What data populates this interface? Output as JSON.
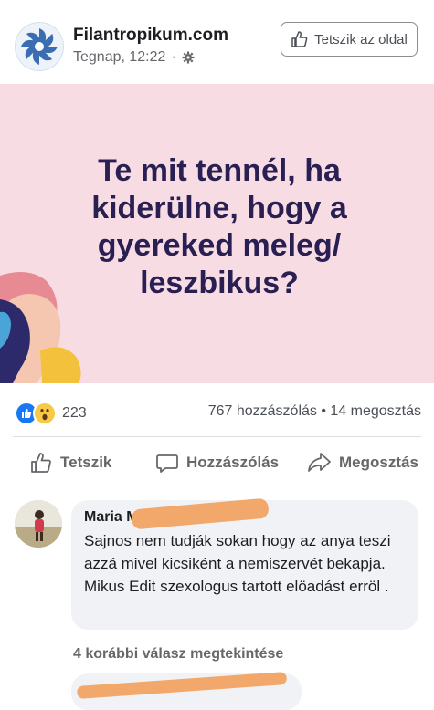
{
  "post": {
    "page_name": "Filantropikum.com",
    "timestamp": "Tegnap, 12:22",
    "meta_separator": "·",
    "privacy_icon": "gear-icon",
    "like_page_button": "Tetszik az oldal",
    "banner_text": "Te mit tennél, ha kiderülne, hogy a gyereked meleg/ leszbikus?",
    "banner_color": "#f7dde3"
  },
  "stats": {
    "reaction_icons": [
      "like-icon",
      "wow-icon"
    ],
    "reaction_count": "223",
    "comments_shares": "767 hozzászólás • 14 megosztás"
  },
  "actions": {
    "like": "Tetszik",
    "comment": "Hozzászólás",
    "share": "Megosztás"
  },
  "comments": {
    "first": {
      "author": "Maria M",
      "text": "Sajnos nem tudják sokan hogy az anya teszi azzá mivel kicsiként a nemiszervét bekapja. Mikus Edit szexologus tartott elöadást erröl ."
    },
    "more_replies": "4 korábbi válasz megtekintése"
  },
  "colors": {
    "accent": "#1877f2",
    "banner_text": "#2a1f52",
    "redaction": "#f1a86a"
  }
}
